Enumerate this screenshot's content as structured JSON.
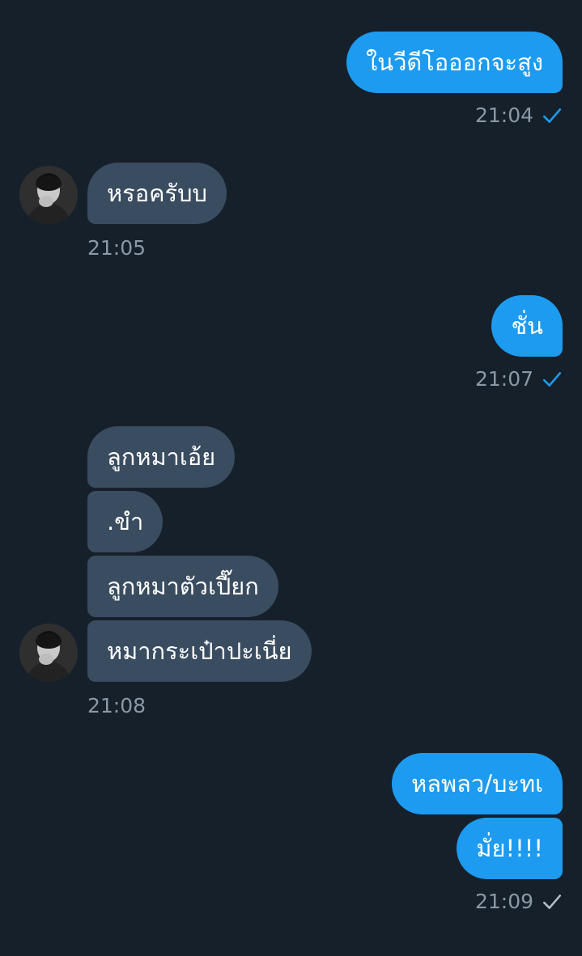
{
  "colors": {
    "background": "#16202b",
    "outgoing_bubble": "#1d9bf0",
    "incoming_bubble": "#3a4c60",
    "timestamp_text": "#8b98a5",
    "read_check": "#1d9bf0",
    "sent_check": "#b4bcc4"
  },
  "messages": [
    {
      "direction": "outgoing",
      "text": "ในวีดีโอออกจะสูง"
    },
    {
      "direction": "outgoing",
      "time": "21:04",
      "status": "read-check-icon"
    },
    {
      "direction": "incoming",
      "text": "หรอครับบ"
    },
    {
      "direction": "incoming",
      "time": "21:05"
    },
    {
      "direction": "outgoing",
      "text": "ชั่น"
    },
    {
      "direction": "outgoing",
      "time": "21:07",
      "status": "read-check-icon"
    },
    {
      "direction": "incoming",
      "text": "ลูกหมาเอ้ย"
    },
    {
      "direction": "incoming",
      "text": ".ขำ"
    },
    {
      "direction": "incoming",
      "text": "ลูกหมาตัวเปี๊ยก"
    },
    {
      "direction": "incoming",
      "text": "หมากระเป๋าปะเนี่ย"
    },
    {
      "direction": "incoming",
      "time": "21:08"
    },
    {
      "direction": "outgoing",
      "text": "หลพลว/บะทเ"
    },
    {
      "direction": "outgoing",
      "text": "มั่ย!!!!"
    },
    {
      "direction": "outgoing",
      "time": "21:09",
      "status": "sent-check-icon"
    }
  ]
}
